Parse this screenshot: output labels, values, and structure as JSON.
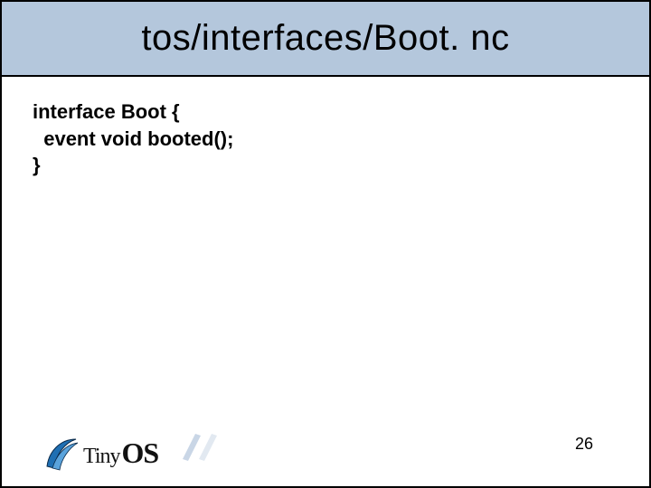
{
  "title": "tos/interfaces/Boot. nc",
  "code": {
    "line1": "interface Boot {",
    "line2": "  event void booted();",
    "line3": "}"
  },
  "logo": {
    "tiny": "Tiny",
    "os": "OS"
  },
  "page_number": "26"
}
